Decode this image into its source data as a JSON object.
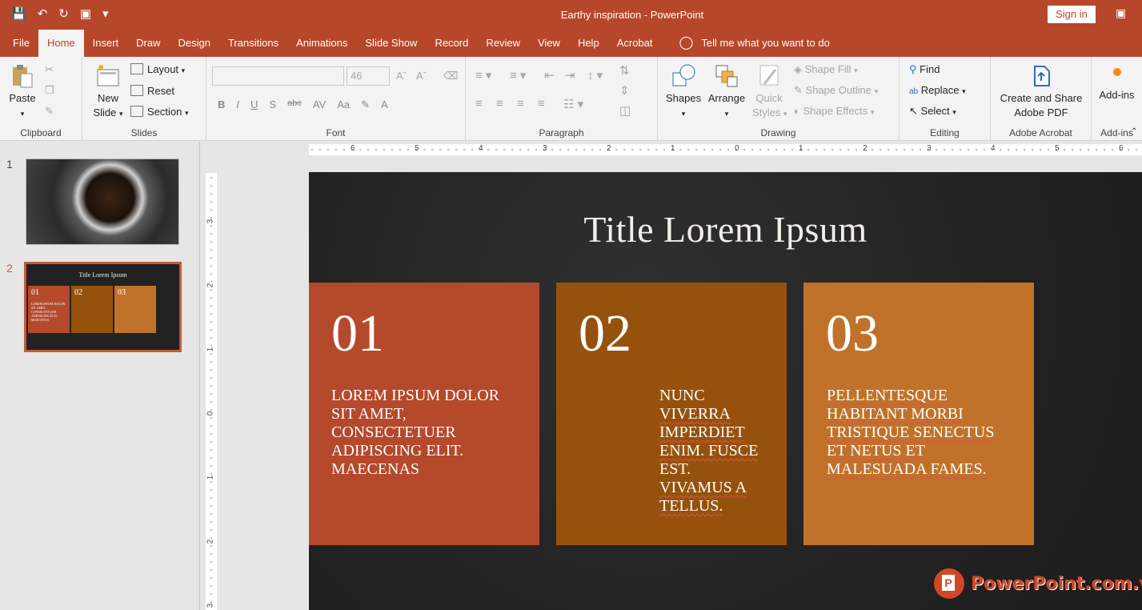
{
  "window": {
    "title": "Earthy inspiration - PowerPoint",
    "sign_in": "Sign in",
    "qat_icons": [
      "save-icon",
      "undo-icon",
      "redo-icon",
      "present-icon",
      "customize-icon"
    ]
  },
  "tabs": [
    "File",
    "Home",
    "Insert",
    "Draw",
    "Design",
    "Transitions",
    "Animations",
    "Slide Show",
    "Record",
    "Review",
    "View",
    "Help",
    "Acrobat"
  ],
  "active_tab": "Home",
  "tell_me": "Tell me what you want to do",
  "ribbon": {
    "clipboard": {
      "label": "Clipboard",
      "paste": "Paste"
    },
    "slides": {
      "label": "Slides",
      "new_slide_1": "New",
      "new_slide_2": "Slide",
      "layout": "Layout",
      "reset": "Reset",
      "section": "Section"
    },
    "font": {
      "label": "Font",
      "size": "46",
      "format": [
        "B",
        "I",
        "U",
        "S",
        "abc",
        "AV",
        "Aa",
        "A"
      ]
    },
    "paragraph": {
      "label": "Paragraph"
    },
    "drawing": {
      "label": "Drawing",
      "shapes": "Shapes",
      "arrange": "Arrange",
      "quick_1": "Quick",
      "quick_2": "Styles",
      "shape_fill": "Shape Fill",
      "shape_outline": "Shape Outline",
      "shape_effects": "Shape Effects"
    },
    "editing": {
      "label": "Editing",
      "find": "Find",
      "replace": "Replace",
      "select": "Select"
    },
    "acrobat": {
      "label": "Adobe Acrobat",
      "create_1": "Create and Share",
      "create_2": "Adobe PDF"
    },
    "addins": {
      "label": "Add-ins",
      "button": "Add-ins"
    }
  },
  "thumbnails": {
    "numbers": [
      "1",
      "2"
    ],
    "mini_title": "Title Lorem Ipsum",
    "mini_nums": [
      "01",
      "02",
      "03"
    ]
  },
  "ruler": {
    "h": [
      "6",
      "5",
      "4",
      "3",
      "2",
      "1",
      "0",
      "1",
      "2",
      "3",
      "4",
      "5",
      "6"
    ],
    "v": [
      "3",
      "2",
      "1",
      "0",
      "1",
      "2",
      "3"
    ]
  },
  "slide": {
    "title": "Title Lorem Ipsum",
    "cards": [
      {
        "num": "01",
        "text": "LOREM IPSUM DOLOR SIT AMET, CONSECTETUER ADIPISCING ELIT. MAECENAS",
        "color": "#b5492c"
      },
      {
        "num": "02",
        "lines": [
          "NUNC",
          "VIVERRA",
          "IMPERDIET",
          "ENIM. FUSCE",
          "EST.",
          "VIVAMUS A",
          "TELLUS."
        ],
        "color": "#96520c"
      },
      {
        "num": "03",
        "lines": [
          "PELLENTESQUE",
          "HABITANT MORBI",
          "TRISTIQUE SENECTUS",
          "ET NETUS ET",
          "MALESUADA FAMES."
        ],
        "color": "#c0722a"
      }
    ]
  },
  "watermark": {
    "text": "PowerPoint.com.vn",
    "badge": "P"
  }
}
